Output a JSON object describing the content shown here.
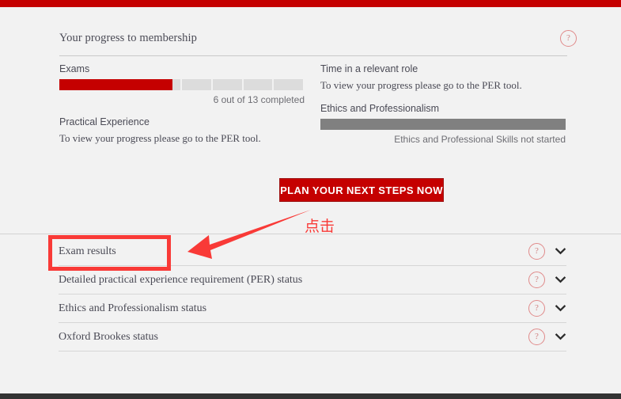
{
  "theme": {
    "brand_red": "#c50000",
    "annotation_red": "#f93a37",
    "track_grey": "#dcdcdc",
    "bar_grey": "#808080",
    "page_bg": "#f2f2f2",
    "text": "#4a4a55"
  },
  "progress_panel": {
    "title": "Your progress to membership",
    "help_icon": "?",
    "left_column": {
      "exams": {
        "label": "Exams",
        "caption": "6 out of 13 completed",
        "completed": 6,
        "total": 13,
        "percent": 46,
        "segments": 8,
        "filled_color": "#c50000"
      },
      "practical_experience": {
        "label": "Practical Experience",
        "note": "To view your progress please go to the PER tool."
      }
    },
    "right_column": {
      "time_in_role": {
        "label": "Time in a relevant role",
        "note": "To view your progress please go to the PER tool."
      },
      "ethics": {
        "label": "Ethics and Professionalism",
        "caption": "Ethics and Professional Skills not started",
        "percent": 0,
        "bar_color": "#808080"
      }
    },
    "cta_button": "PLAN YOUR NEXT STEPS NOW"
  },
  "accordion": {
    "rows": [
      {
        "label": "Exam results",
        "help_icon": "?",
        "expanded": false
      },
      {
        "label": "Detailed practical experience requirement (PER) status",
        "help_icon": "?",
        "expanded": false
      },
      {
        "label": "Ethics and Professionalism status",
        "help_icon": "?",
        "expanded": false
      },
      {
        "label": "Oxford Brookes status",
        "help_icon": "?",
        "expanded": false
      }
    ]
  },
  "annotation": {
    "callout_text": "点击",
    "highlight_target": "Exam results",
    "arrow_direction": "points-left-down"
  }
}
